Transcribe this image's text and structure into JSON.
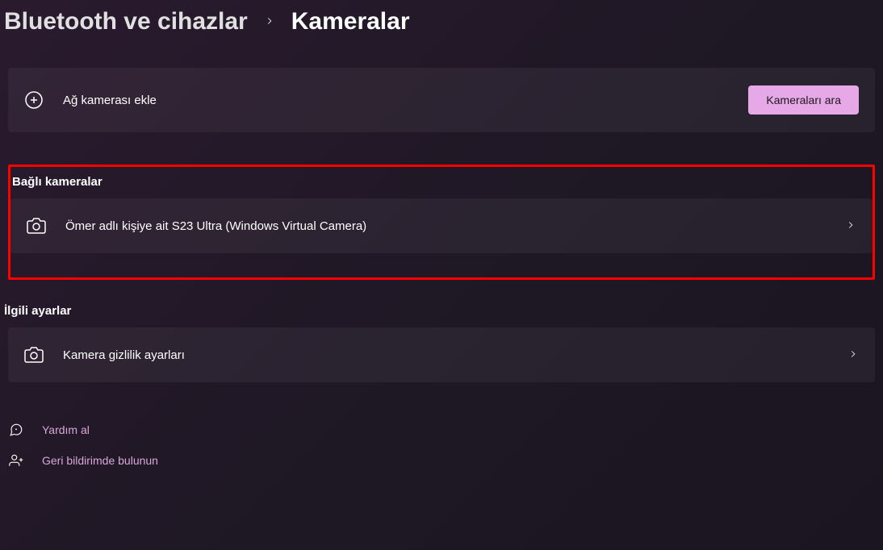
{
  "breadcrumb": {
    "parent": "Bluetooth ve cihazlar",
    "current": "Kameralar"
  },
  "addCamera": {
    "label": "Ağ kamerası ekle",
    "button": "Kameraları ara"
  },
  "connectedCameras": {
    "header": "Bağlı kameralar",
    "items": [
      {
        "label": "Ömer adlı kişiye ait S23 Ultra (Windows Virtual Camera)"
      }
    ]
  },
  "relatedSettings": {
    "header": "İlgili ayarlar",
    "items": [
      {
        "label": "Kamera gizlilik ayarları"
      }
    ]
  },
  "helpLinks": {
    "help": "Yardım al",
    "feedback": "Geri bildirimde bulunun"
  }
}
